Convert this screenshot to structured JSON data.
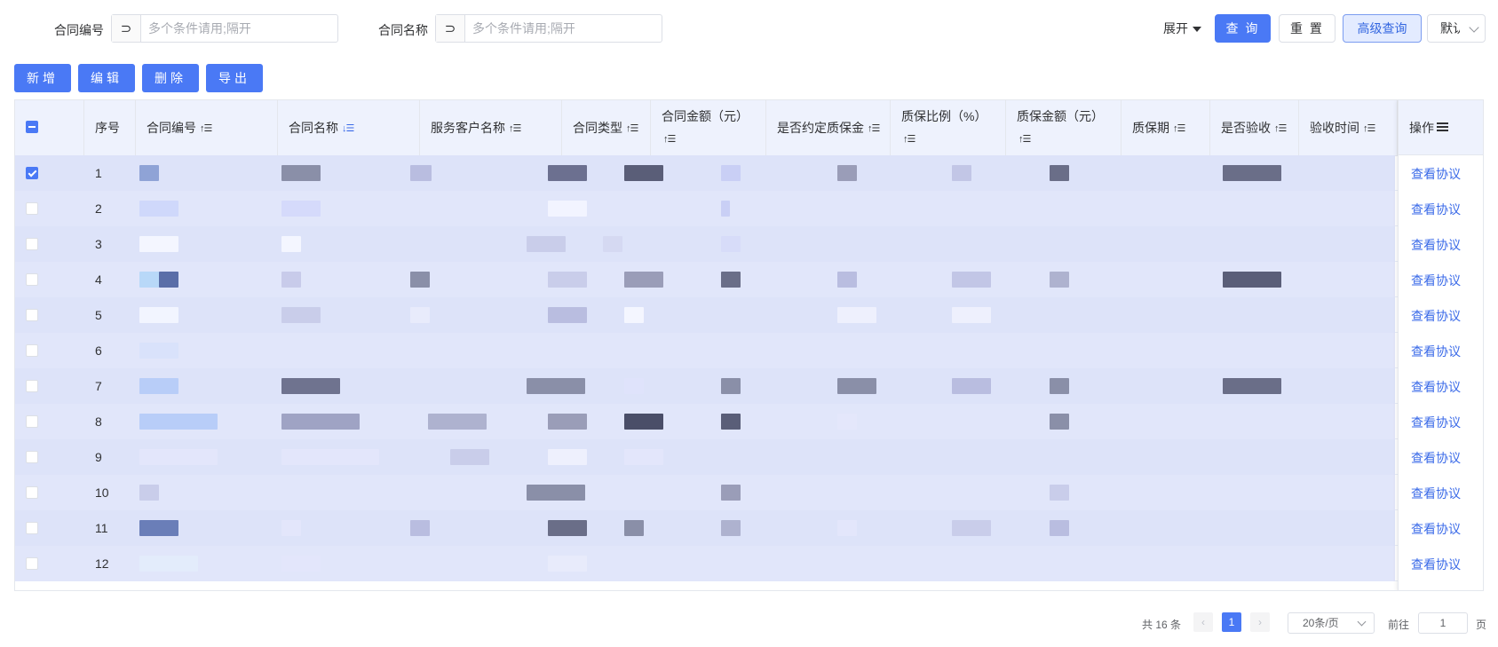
{
  "search": {
    "contract_no_label": "合同编号",
    "contract_no_prefix": "⊃",
    "contract_no_placeholder": "多个条件请用;隔开",
    "contract_name_label": "合同名称",
    "contract_name_prefix": "⊃",
    "contract_name_placeholder": "多个条件请用;隔开",
    "expand_label": "展开",
    "query_label": "查 询",
    "reset_label": "重 置",
    "advanced_label": "高级查询",
    "default_select_label": "默认"
  },
  "toolbar": {
    "add_label": "新增",
    "edit_label": "编辑",
    "delete_label": "删除",
    "export_label": "导出"
  },
  "table": {
    "columns": {
      "index": "序号",
      "contract_no": "合同编号",
      "contract_name": "合同名称",
      "customer": "服务客户名称",
      "contract_type": "合同类型",
      "amount": "合同金额（元）",
      "has_warranty_deposit": "是否约定质保金",
      "warranty_ratio": "质保比例（%）",
      "warranty_amount": "质保金额（元）",
      "warranty_period": "质保期",
      "accepted": "是否验收",
      "acceptance_time": "验收时间",
      "actions": "操作"
    },
    "sort_glyph": "↑☰",
    "sort_glyph_active": "↓☰",
    "rows": [
      {
        "index": "1",
        "checked": true,
        "action": "查看协议"
      },
      {
        "index": "2",
        "checked": false,
        "action": "查看协议"
      },
      {
        "index": "3",
        "checked": false,
        "action": "查看协议"
      },
      {
        "index": "4",
        "checked": false,
        "action": "查看协议"
      },
      {
        "index": "5",
        "checked": false,
        "action": "查看协议"
      },
      {
        "index": "6",
        "checked": false,
        "action": "查看协议"
      },
      {
        "index": "7",
        "checked": false,
        "action": "查看协议"
      },
      {
        "index": "8",
        "checked": false,
        "action": "查看协议"
      },
      {
        "index": "9",
        "checked": false,
        "action": "查看协议"
      },
      {
        "index": "10",
        "checked": false,
        "action": "查看协议"
      },
      {
        "index": "11",
        "checked": false,
        "action": "查看协议"
      },
      {
        "index": "12",
        "checked": false,
        "action": "查看协议"
      }
    ]
  },
  "pagination": {
    "total": "共 16 条",
    "prev": "‹",
    "current_page": "1",
    "next": "›",
    "page_size": "20条/页",
    "goto_label": "前往",
    "goto_value": "1",
    "page_suffix": "页"
  },
  "colors": {
    "primary": "#4a79f5",
    "link": "#3a6ae8",
    "row_shade": "#dde3f9",
    "header_bg": "#eef2fd"
  }
}
